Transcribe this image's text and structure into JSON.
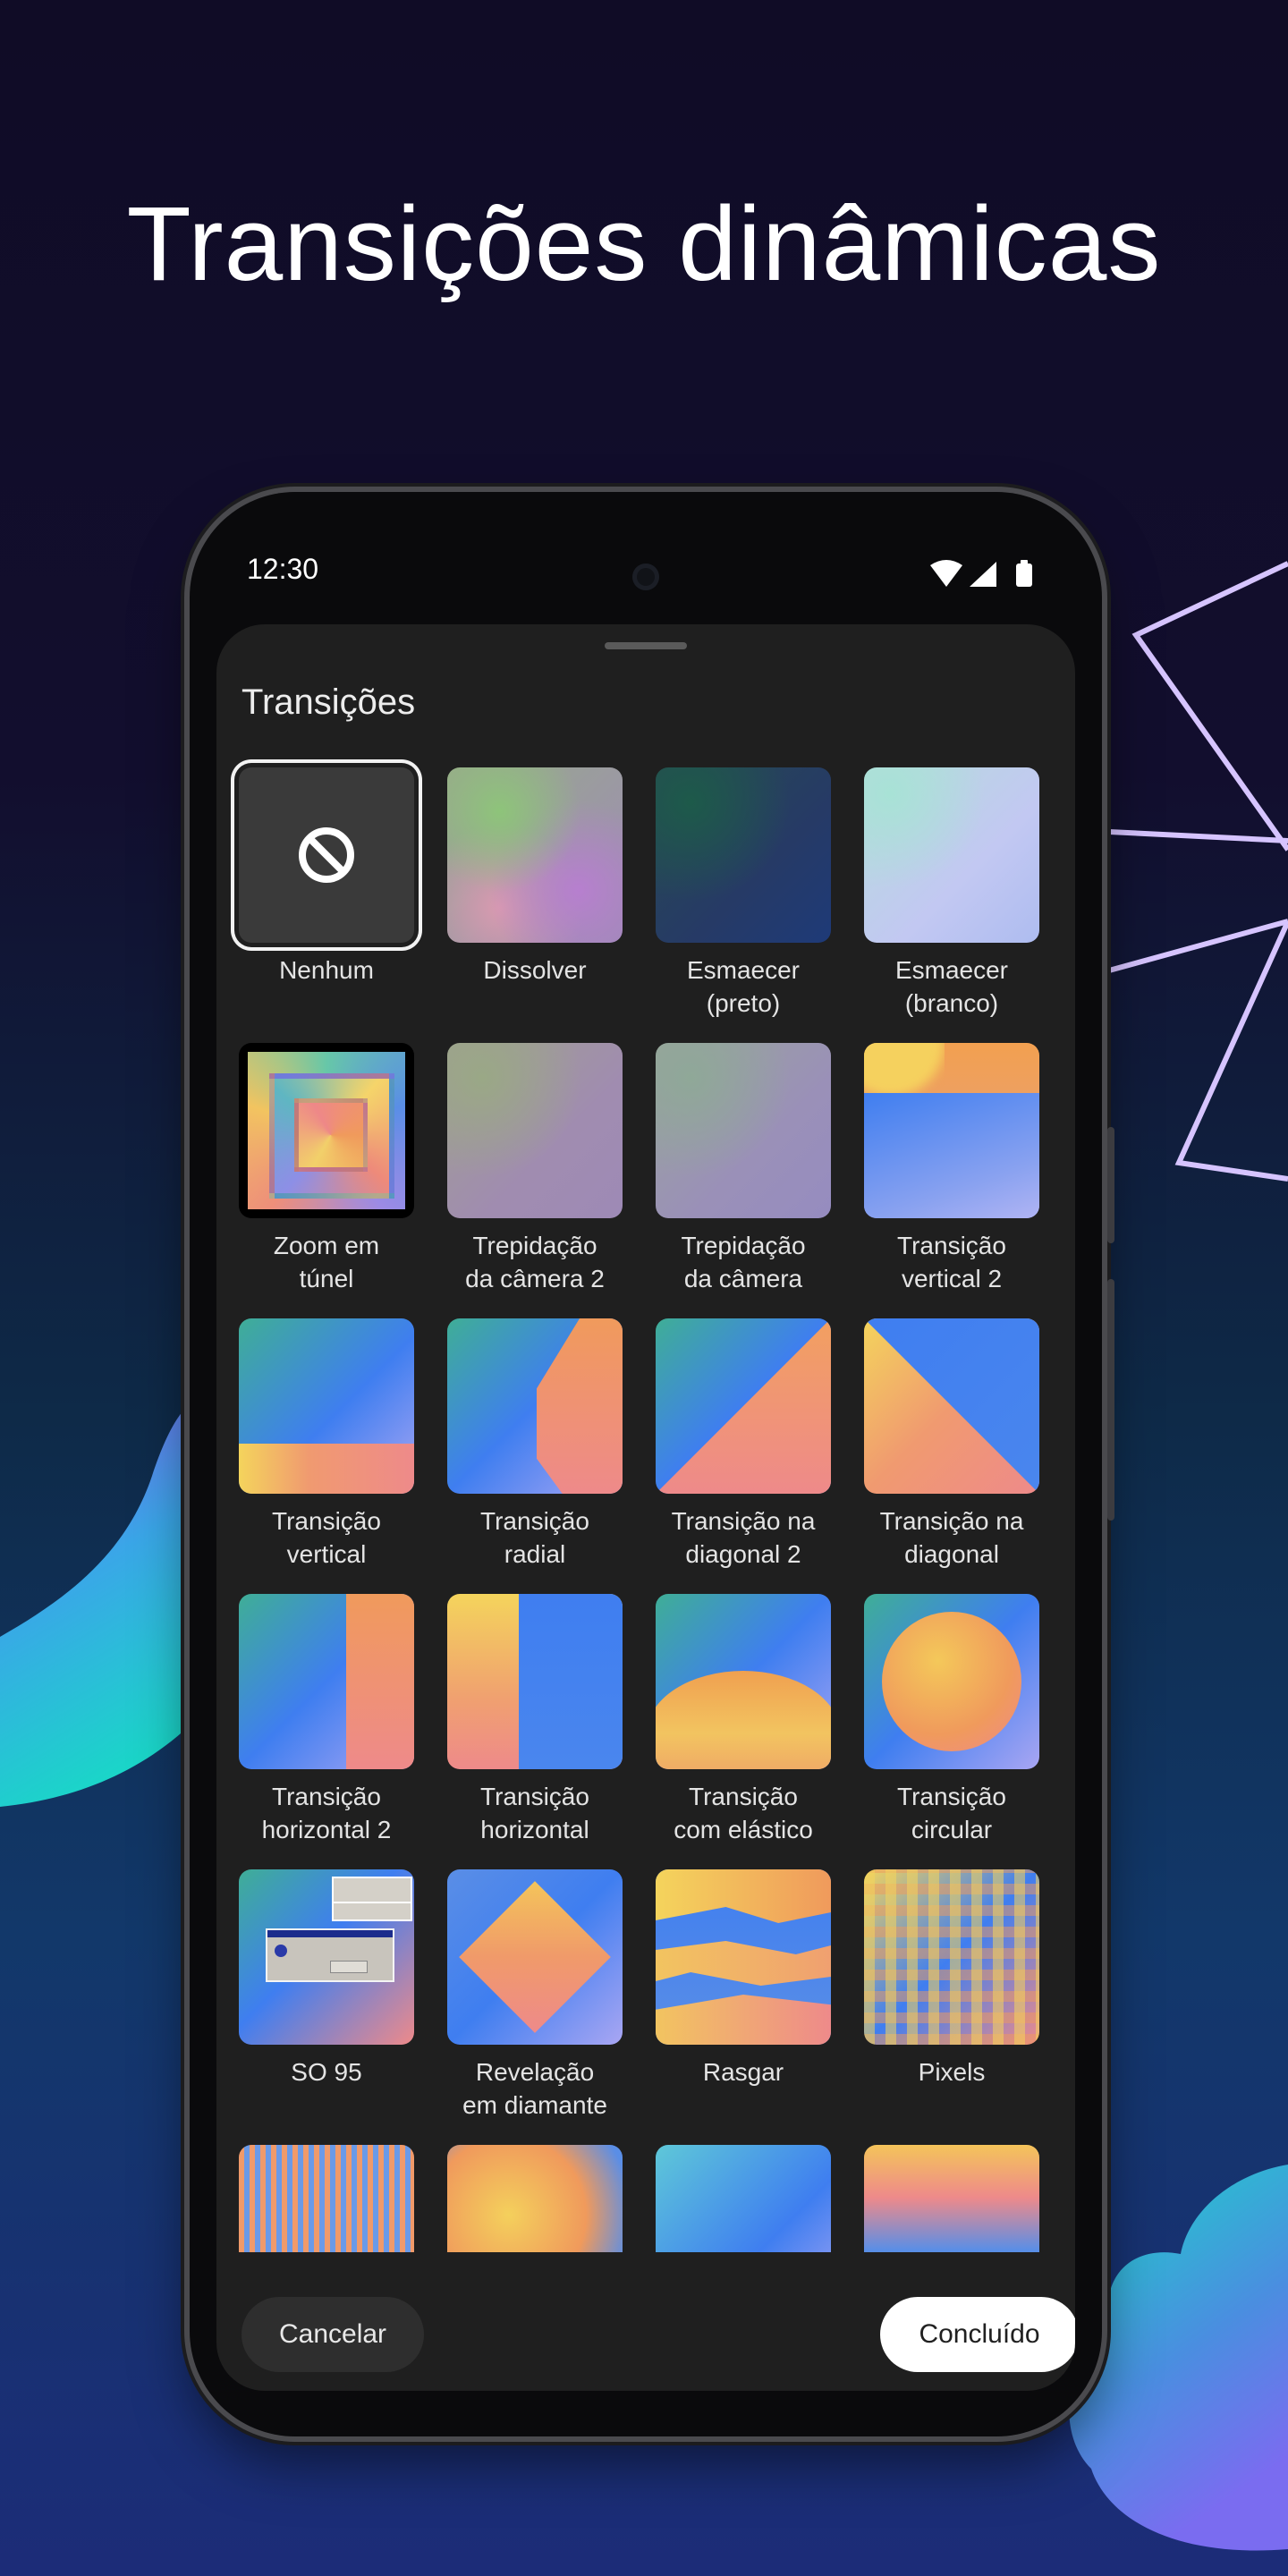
{
  "headline": "Transições dinâmicas",
  "status_bar": {
    "time": "12:30",
    "icons": [
      "wifi-icon",
      "signal-icon",
      "battery-icon"
    ]
  },
  "sheet": {
    "title": "Transições",
    "cancel_label": "Cancelar",
    "done_label": "Concluído",
    "selected": "Nenhum",
    "transitions": [
      {
        "line1": "Nenhum",
        "line2": ""
      },
      {
        "line1": "Dissolver",
        "line2": ""
      },
      {
        "line1": "Esmaecer",
        "line2": "(preto)"
      },
      {
        "line1": "Esmaecer",
        "line2": "(branco)"
      },
      {
        "line1": "Zoom em",
        "line2": "túnel"
      },
      {
        "line1": "Trepidação",
        "line2": "da câmera 2"
      },
      {
        "line1": "Trepidação",
        "line2": "da câmera"
      },
      {
        "line1": "Transição",
        "line2": "vertical 2"
      },
      {
        "line1": "Transição",
        "line2": "vertical"
      },
      {
        "line1": "Transição",
        "line2": "radial"
      },
      {
        "line1": "Transição na",
        "line2": "diagonal 2"
      },
      {
        "line1": "Transição na",
        "line2": "diagonal"
      },
      {
        "line1": "Transição",
        "line2": "horizontal 2"
      },
      {
        "line1": "Transição",
        "line2": "horizontal"
      },
      {
        "line1": "Transição",
        "line2": "com elástico"
      },
      {
        "line1": "Transição",
        "line2": "circular"
      },
      {
        "line1": "SO 95",
        "line2": ""
      },
      {
        "line1": "Revelação",
        "line2": "em diamante"
      },
      {
        "line1": "Rasgar",
        "line2": ""
      },
      {
        "line1": "Pixels",
        "line2": ""
      },
      {
        "line1": "",
        "line2": ""
      },
      {
        "line1": "",
        "line2": ""
      },
      {
        "line1": "",
        "line2": ""
      },
      {
        "line1": "",
        "line2": ""
      }
    ]
  },
  "colors": {
    "sheet_bg": "#1f1f1f",
    "accent_blue": "#3f7ef0",
    "accent_orange": "#f0955a",
    "accent_yellow": "#f4d45c",
    "accent_pink": "#ee8a8a"
  }
}
